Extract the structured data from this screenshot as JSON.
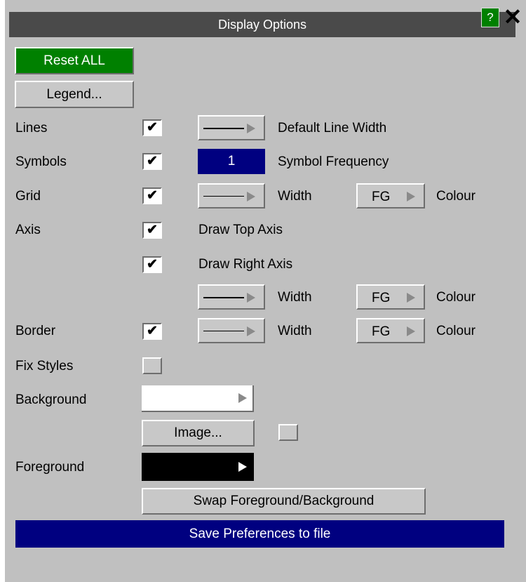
{
  "window": {
    "title": "Display Options",
    "help_label": "?",
    "close_label": "✕"
  },
  "buttons": {
    "reset_all": "Reset ALL",
    "legend": "Legend...",
    "image": "Image...",
    "swap": "Swap Foreground/Background",
    "save": "Save Preferences to file"
  },
  "rows": {
    "lines": {
      "label": "Lines",
      "checked": true,
      "control_label": "Default Line Width"
    },
    "symbols": {
      "label": "Symbols",
      "checked": true,
      "frequency_value": "1",
      "control_label": "Symbol Frequency"
    },
    "grid": {
      "label": "Grid",
      "checked": true,
      "width_label": "Width",
      "colour_value": "FG",
      "colour_label": "Colour"
    },
    "axis": {
      "label": "Axis",
      "top_checked": true,
      "top_label": "Draw Top Axis",
      "right_checked": true,
      "right_label": "Draw Right Axis",
      "width_label": "Width",
      "colour_value": "FG",
      "colour_label": "Colour"
    },
    "border": {
      "label": "Border",
      "checked": true,
      "width_label": "Width",
      "colour_value": "FG",
      "colour_label": "Colour"
    },
    "fix_styles": {
      "label": "Fix Styles",
      "checked": false
    },
    "background": {
      "label": "Background",
      "color": "#ffffff"
    },
    "foreground": {
      "label": "Foreground",
      "color": "#000000"
    }
  },
  "check_glyph": "✔",
  "colors": {
    "reset_green": "#008000",
    "symbol_blue": "#000080",
    "save_blue": "#000080"
  }
}
